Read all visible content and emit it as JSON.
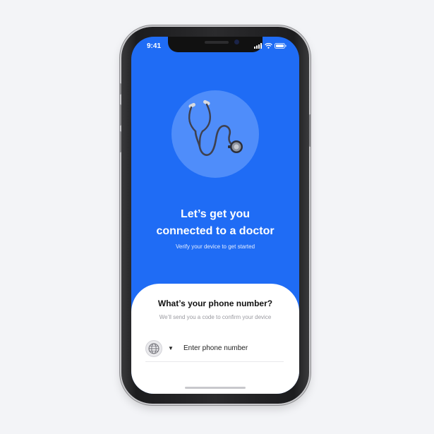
{
  "status_bar": {
    "time": "9:41"
  },
  "hero": {
    "icon": "stethoscope-icon",
    "headline_line1": "Let’s get you",
    "headline_line2": "connected to a doctor",
    "subtitle": "Verify your device to get started"
  },
  "sheet": {
    "title": "What’s your phone number?",
    "subtitle": "We’ll send you a code to confirm your device",
    "country_icon": "globe-icon",
    "phone_placeholder": "Enter phone number"
  },
  "colors": {
    "primary": "#1f6cf5",
    "hero_circle": "#4f8dfa",
    "sheet_background": "#ffffff"
  }
}
